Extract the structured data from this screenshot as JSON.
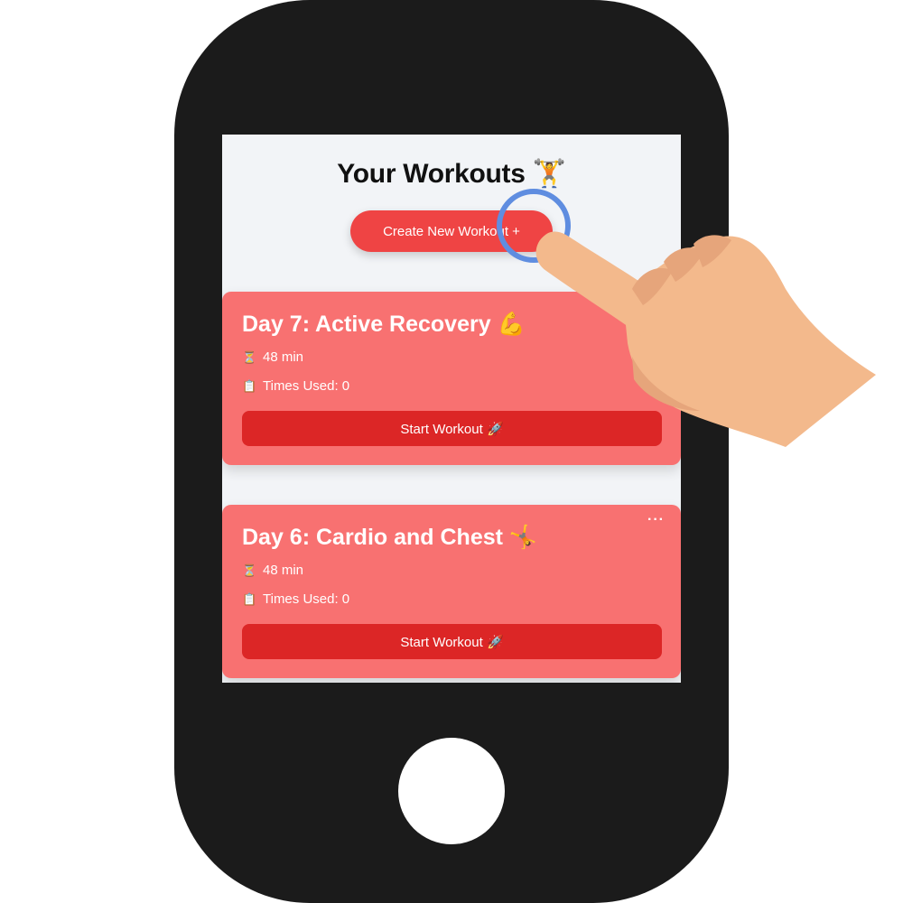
{
  "app": {
    "title": "Your Workouts 🏋️"
  },
  "create_button": {
    "label": "Create New Workout +"
  },
  "workouts": [
    {
      "title": "Day 7: Active Recovery 💪",
      "duration_icon": "⏳",
      "duration": "48 min",
      "uses_icon": "📋",
      "times_used": "Times Used: 0",
      "start_label": "Start Workout 🚀"
    },
    {
      "title": "Day 6: Cardio and Chest 🤸",
      "duration_icon": "⏳",
      "duration": "48 min",
      "uses_icon": "📋",
      "times_used": "Times Used: 0",
      "start_label": "Start Workout 🚀",
      "more_label": "···"
    }
  ],
  "colors": {
    "card": "#f87171",
    "card_button": "#dc2626",
    "create_button": "#ef4444",
    "tap_ring": "#5f8de0"
  },
  "overlay": {
    "gesture": "tap",
    "icon": "pointing-hand-icon"
  }
}
